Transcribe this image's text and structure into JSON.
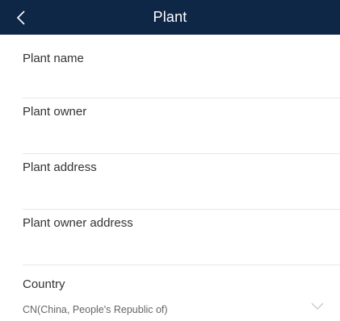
{
  "header": {
    "title": "Plant",
    "back_icon": "chevron-left-icon"
  },
  "form": {
    "plant_name": {
      "label": "Plant name",
      "value": ""
    },
    "plant_owner": {
      "label": "Plant owner",
      "value": ""
    },
    "plant_address": {
      "label": "Plant address",
      "value": ""
    },
    "plant_owner_address": {
      "label": "Plant owner address",
      "value": ""
    },
    "country": {
      "label": "Country",
      "value": "CN(China, People's Republic of)",
      "dropdown_icon": "chevron-down-icon"
    }
  },
  "colors": {
    "header_bg": "#0f2746",
    "header_text": "#ffffff",
    "divider": "#e6e6e6"
  }
}
